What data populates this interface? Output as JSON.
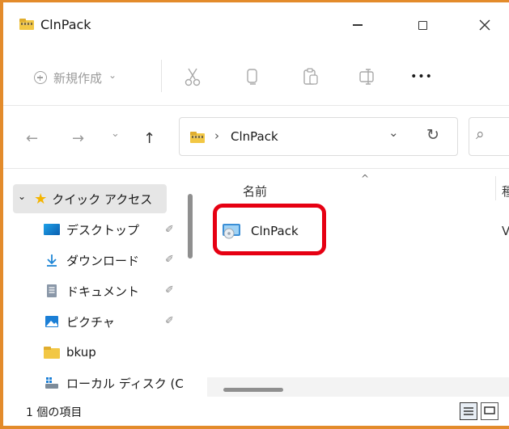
{
  "window": {
    "title": "ClnPack",
    "minimize_glyph": "—",
    "maximize_glyph": "☐",
    "close_glyph": "✕"
  },
  "toolbar": {
    "new_label": "新規作成",
    "new_chevron": "⌄",
    "cut_icon": "scissors-icon",
    "copy_icon": "copy-icon",
    "paste_icon": "paste-icon",
    "rename_icon": "rename-icon",
    "more_label": "•••"
  },
  "navigation": {
    "back_glyph": "←",
    "forward_glyph": "→",
    "recent_glyph": "⌄",
    "up_glyph": "↑"
  },
  "address": {
    "separator": "›",
    "path_label": "ClnPack",
    "dropdown_glyph": "⌄",
    "refresh_glyph": "↻",
    "search_glyph": "⌕"
  },
  "sidebar": {
    "quick_access": {
      "chevron": "⌄",
      "label": "クイック アクセス",
      "star_color": "#f4b400"
    },
    "items": [
      {
        "label": "デスクトップ",
        "icon": "desktop-icon",
        "pinned": true
      },
      {
        "label": "ダウンロード",
        "icon": "download-icon",
        "pinned": true
      },
      {
        "label": "ドキュメント",
        "icon": "document-icon",
        "pinned": true
      },
      {
        "label": "ピクチャ",
        "icon": "picture-icon",
        "pinned": true
      },
      {
        "label": "bkup",
        "icon": "folder-icon",
        "pinned": false
      },
      {
        "label": "ローカル ディスク (C",
        "icon": "drive-icon",
        "pinned": false
      }
    ],
    "pin_glyph": "📌"
  },
  "content": {
    "sort_glyph": "^",
    "column_name": "名前",
    "column_next_partial": "種",
    "files": [
      {
        "name": "ClnPack",
        "icon": "setup-icon",
        "next_col_partial": "V"
      }
    ]
  },
  "status": {
    "item_count": "1 個の項目",
    "details_view_icon": "details-view-icon",
    "tiles_view_icon": "tiles-view-icon"
  },
  "colors": {
    "frame_border": "#e38b2b",
    "highlight": "#e60012",
    "selection": "#e6e6e6"
  }
}
